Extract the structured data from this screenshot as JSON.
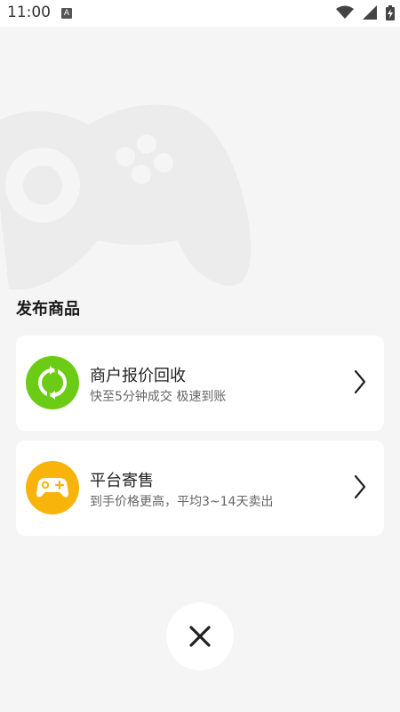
{
  "status_bar": {
    "time": "11:00",
    "notification_icon": "a-icon",
    "notification_glyph": "A",
    "icons": [
      "wifi-icon",
      "signal-icon",
      "battery-charging-icon"
    ]
  },
  "background": {
    "decoration_icon": "gamepad-icon"
  },
  "page": {
    "title": "发布商品"
  },
  "options": [
    {
      "title": "商户报价回收",
      "subtitle": "快至5分钟成交 极速到账",
      "icon": "recycle-icon",
      "icon_color": "#6ccc15"
    },
    {
      "title": "平台寄售",
      "subtitle": "到手价格更高，平均3~14天卖出",
      "icon": "gamepad-icon",
      "icon_color": "#f8b40a"
    }
  ],
  "close_button": {
    "icon": "close-icon"
  }
}
